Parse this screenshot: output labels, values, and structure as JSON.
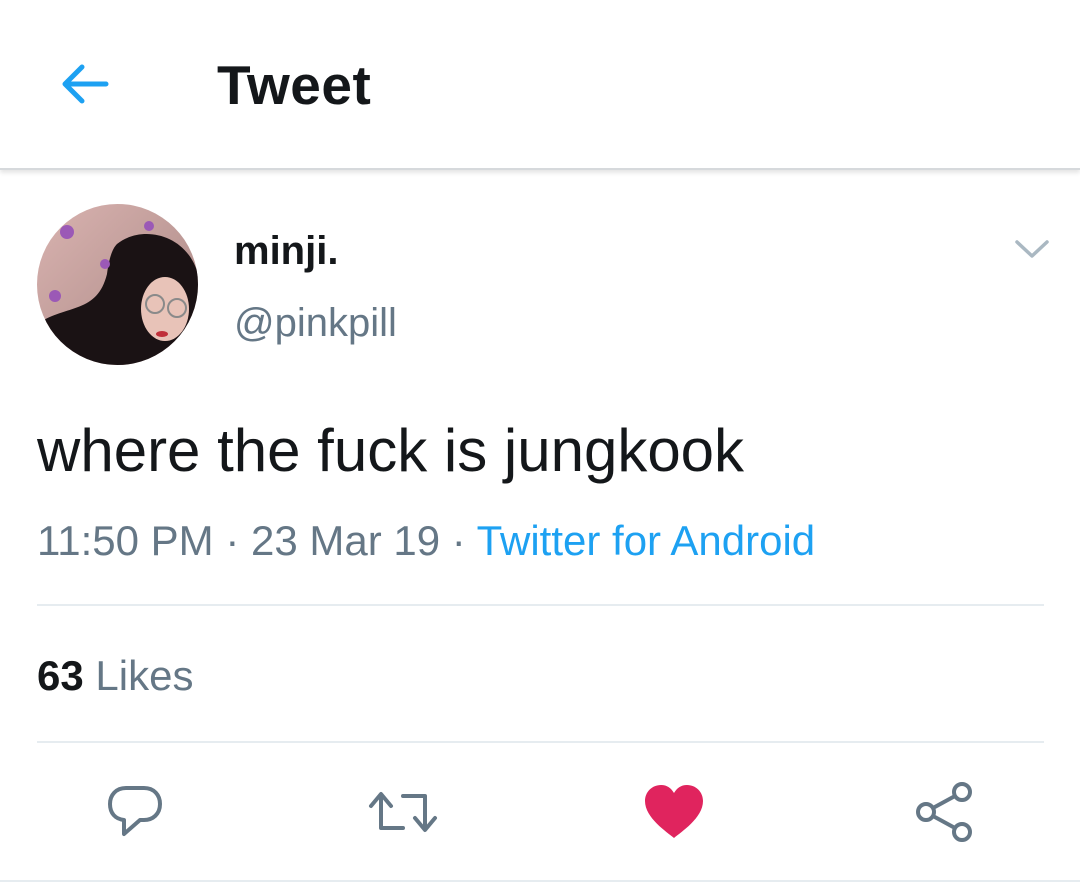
{
  "header": {
    "title": "Tweet",
    "back_icon": "back-arrow-icon"
  },
  "tweet": {
    "display_name": "minji.",
    "handle": "@pinkpill",
    "text": "where the fuck is jungkook",
    "time": "11:50 PM",
    "separator": " · ",
    "date": "23 Mar 19",
    "source": "Twitter for Android",
    "menu_icon": "chevron-down-icon"
  },
  "stats": {
    "likes_count": "63",
    "likes_label": "Likes"
  },
  "actions": [
    {
      "name": "reply",
      "icon": "comment-icon"
    },
    {
      "name": "retweet",
      "icon": "retweet-icon"
    },
    {
      "name": "like",
      "icon": "heart-icon",
      "active": true
    },
    {
      "name": "share",
      "icon": "share-icon"
    }
  ],
  "colors": {
    "accent": "#1da1f2",
    "like": "#e0245e",
    "text": "#14171a",
    "secondary_text": "#657786",
    "divider": "#e6ecf0"
  }
}
